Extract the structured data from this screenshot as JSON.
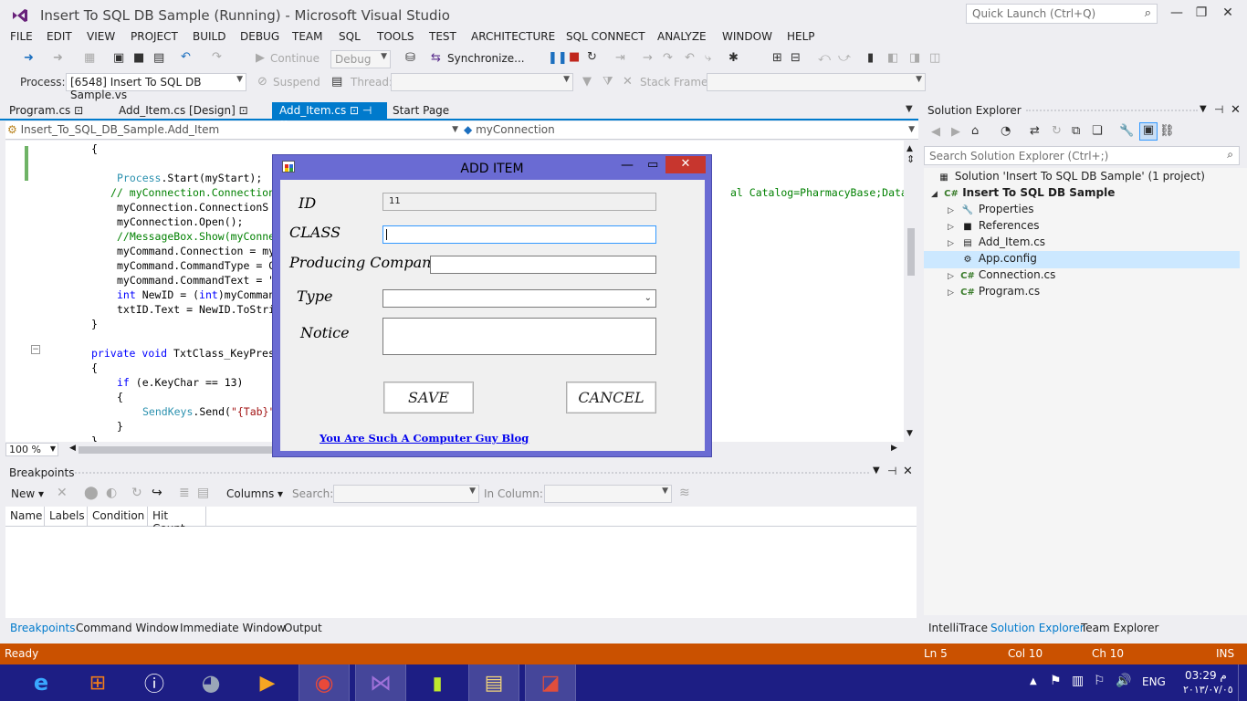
{
  "window": {
    "title": "Insert To SQL DB Sample (Running) - Microsoft Visual Studio",
    "quick_launch": "Quick Launch (Ctrl+Q)"
  },
  "menu": [
    "FILE",
    "EDIT",
    "VIEW",
    "PROJECT",
    "BUILD",
    "DEBUG",
    "TEAM",
    "SQL",
    "TOOLS",
    "TEST",
    "ARCHITECTURE",
    "SQL CONNECT",
    "ANALYZE",
    "WINDOW",
    "HELP"
  ],
  "toolbar": {
    "continue_label": "Continue",
    "config": "Debug",
    "synchronize": "Synchronize...",
    "process_label": "Process:",
    "process_value": "[6548] Insert To SQL DB Sample.vs",
    "suspend_label": "Suspend",
    "thread_label": "Thread:",
    "stackframe_label": "Stack Frame:"
  },
  "tabs": [
    {
      "label": "Program.cs",
      "pin": "⊡"
    },
    {
      "label": "Add_Item.cs [Design]",
      "pin": "⊡"
    },
    {
      "label": "Add_Item.cs",
      "pin": "⊡ ⊣ ✕"
    },
    {
      "label": "Start Page",
      "pin": ""
    }
  ],
  "nav": {
    "left": "Insert_To_SQL_DB_Sample.Add_Item",
    "right": "myConnection"
  },
  "code": {
    "l1": "{",
    "l2a": "Process",
    "l2b": ".Start(myStart);",
    "l3": "// myConnection.Connection",
    "l3r": "al Catalog=PharmacyBase;Data S",
    "l4": "myConnection.ConnectionS",
    "l5": "myConnection.Open();",
    "l6": "//MessageBox.Show(myConne",
    "l7": "myCommand.Connection = my",
    "l8": "myCommand.CommandType = C",
    "l9": "myCommand.CommandText = \"",
    "l10a": "int",
    "l10b": " NewID = (",
    "l10c": "int",
    "l10d": ")myComman",
    "l11": "txtID.Text = NewID.ToStri",
    "l12": "}",
    "l13a": "private",
    "l13b": " ",
    "l13c": "void",
    "l13d": " TxtClass_KeyPres",
    "l14": "{",
    "l15a": "if",
    "l15b": " (e.KeyChar == 13)",
    "l16": "{",
    "l17a": "SendKeys",
    "l17b": ".Send(",
    "l17c": "\"{Tab}\"",
    "l18": "}",
    "l19": "}"
  },
  "zoom": "100 %",
  "breakpoints": {
    "title": "Breakpoints",
    "new_label": "New ▾",
    "columns_label": "Columns ▾",
    "search_label": "Search:",
    "incolumn_label": "In Column:",
    "cols": [
      "Name",
      "Labels",
      "Condition",
      "Hit Count"
    ]
  },
  "bottom_tabs": [
    "Breakpoints",
    "Command Window",
    "Immediate Window",
    "Output"
  ],
  "solution_explorer": {
    "title": "Solution Explorer",
    "search": "Search Solution Explorer (Ctrl+;)",
    "solution": "Solution 'Insert To SQL DB Sample' (1 project)",
    "project": "Insert To SQL DB Sample",
    "items": [
      "Properties",
      "References",
      "Add_Item.cs",
      "App.config",
      "Connection.cs",
      "Program.cs"
    ],
    "bottom_tabs": [
      "IntelliTrace",
      "Solution Explorer",
      "Team Explorer"
    ]
  },
  "status": {
    "ready": "Ready",
    "ln": "Ln 5",
    "col": "Col 10",
    "ch": "Ch 10",
    "ins": "INS"
  },
  "taskbar": {
    "lang": "ENG",
    "time": "03:29 م",
    "date": "٢٠١٣/٠٧/٠٥"
  },
  "dialog": {
    "title": "ADD ITEM",
    "id_label": "ID",
    "id_value": "11",
    "class_label": "CLASS",
    "company_label": "Producing Company",
    "type_label": "Type",
    "notice_label": "Notice",
    "save": "SAVE",
    "cancel": "CANCEL",
    "link": "You Are Such A Computer Guy Blog"
  },
  "colors": {
    "accent": "#007acc",
    "status": "#ca5100",
    "taskbar": "#1d1e84",
    "dialog_frame": "#6a6bd3",
    "close_button": "#c7362e"
  }
}
